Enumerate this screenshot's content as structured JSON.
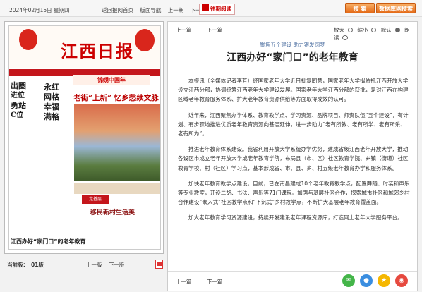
{
  "topbar": {
    "date": "2024年02月15日 星期四",
    "nav": [
      "返回报网首页",
      "版面导航",
      "上一期",
      "下一期"
    ],
    "archive_label": "往期阅读",
    "search_label": "搜 索",
    "search_all_label": "数据库网搜索"
  },
  "paper": {
    "logo": "江西日报",
    "banner": "锦绣中国年",
    "col_left": [
      "出圈",
      "进位",
      "勇站",
      "C位"
    ],
    "col_mid": [
      "永红",
      "网格",
      "幸福",
      "满格"
    ],
    "headline": "老街“上新” 忆乡愁续文脉",
    "tag": "走基层",
    "subhead": "移民新村生活美",
    "bottom_head": "江西办好“家门口”的老年教育"
  },
  "left_footer": {
    "current_label": "当前版：",
    "current_value": "01版",
    "prev": "上一版",
    "next": "下一版"
  },
  "article": {
    "tools_nav": [
      "上一篇",
      "下一篇"
    ],
    "zoom_in": "放大",
    "zoom_out": "缩小",
    "default": "默认",
    "read": "朗读",
    "kicker": "聚焦五个建设 助力银发圆梦",
    "title": "江西办好“家门口”的老年教育",
    "paragraphs": [
      "本报讯（全媒体记者李芳）经国家老年大学近日批复同意，国家老年大学拟依托江西开放大学设立江西分部，协调统筹江西老年大学建设发展。国家老年大学江西分部的获批，是对江西在构建区域老年教育服务体系、扩大老年教育资源供给等方面取得成效的认可。",
      "近年来，江西聚焦办学体系、教育教学点、学习资源、品牌项目、师资队伍“五个建设”，有计划、有步骤地推进优质老年教育资源向基层延伸，进一步助力“老有所教、老有所学、老有所乐、老有所为”。",
      "推进老年教育体系建设。我省利用开放大学系统办学优势，建成省级江西老年开放大学，推动各设区市成立老年开放大学或老年教育学院，布局县（市、区）社区教育学院、乡镇（街道）社区教育学校、村（社区）学习点，基本形成省、市、县、乡、村五级老年教育办学和服务体系。",
      "加快老年教育教学点建设。目前，已在南昌建成10个老年教育教学点，配置舞蹈、时装和声乐等专业教室，开设二胡、书法、声乐等71门课程。加强与基层社区合作，探索城市社区和城郊乡村合作建设“嵌入式”社区教学点和“下沉式”乡村教学点，不断扩大基层老年教育覆盖面。",
      "加大老年教育学习资源建设，持续开发建设老年课程资源库，打造网上老年大学服务平台。"
    ],
    "foot_nav": [
      "上一篇",
      "下一篇"
    ]
  },
  "icons": {
    "archive": "calendar-icon",
    "pdf": "pdf-icon",
    "share": [
      "wechat-icon",
      "qq-icon",
      "qzone-icon",
      "weibo-icon"
    ]
  },
  "colors": {
    "brand_red": "#c4161c",
    "search_orange": "#e46a16",
    "kicker_blue": "#5a7aa8"
  }
}
